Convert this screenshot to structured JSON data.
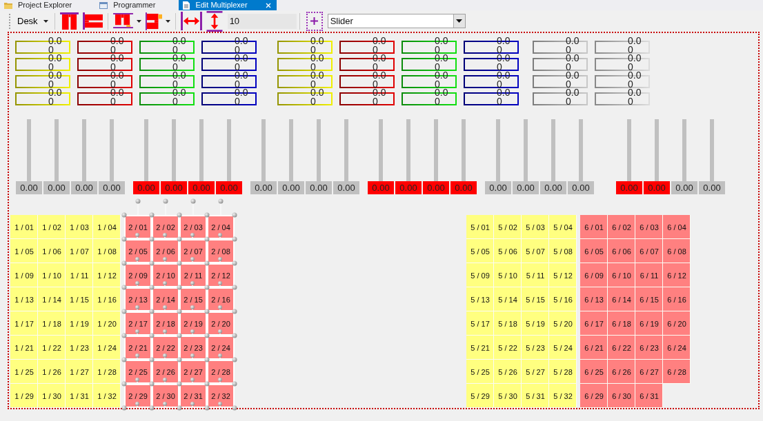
{
  "tabs": [
    {
      "label": "Project Explorer",
      "selected": false
    },
    {
      "label": "Programmer",
      "selected": false
    },
    {
      "label": "Edit Multiplexer",
      "selected": true
    }
  ],
  "toolbar": {
    "desk_menu": {
      "label": "Desk"
    },
    "spacing": {
      "value": "10"
    },
    "mode": {
      "value": "Slider"
    }
  },
  "value_groups": [
    {
      "color": "#f0f000",
      "values": [
        "0.00",
        "0.00",
        "0.00",
        "0.00"
      ]
    },
    {
      "color": "#e00000",
      "values": [
        "0.00",
        "0.00",
        "0.00",
        "0.00"
      ]
    },
    {
      "color": "#10e010",
      "values": [
        "0.00",
        "0.00",
        "0.00",
        "0.00"
      ]
    },
    {
      "color": "#0000c0",
      "values": [
        "0.00",
        "0.00",
        "0.00",
        "0.00"
      ]
    },
    {
      "color": "#f0f000",
      "values": [
        "0.00",
        "0.00",
        "0.00",
        "0.00"
      ]
    },
    {
      "color": "#e00000",
      "values": [
        "0.00",
        "0.00",
        "0.00",
        "0.00"
      ]
    },
    {
      "color": "#10e010",
      "values": [
        "0.00",
        "0.00",
        "0.00",
        "0.00"
      ]
    },
    {
      "color": "#0000c0",
      "values": [
        "0.00",
        "0.00",
        "0.00",
        "0.00"
      ]
    },
    {
      "color": "#c8c8c8",
      "values": [
        "0.00",
        "0.00",
        "0.00",
        "0.00"
      ]
    },
    {
      "color": "#dcdcdc",
      "values": [
        "0.00",
        "0.00",
        "0.00",
        "0.00"
      ]
    }
  ],
  "slider_groups": [
    {
      "sliders": [
        {
          "level": 0,
          "value": "0.00",
          "color": "#c0c0c0"
        },
        {
          "level": 0,
          "value": "0.00",
          "color": "#c0c0c0"
        },
        {
          "level": 0,
          "value": "0.00",
          "color": "#c0c0c0"
        },
        {
          "level": 0,
          "value": "0.00",
          "color": "#c0c0c0"
        }
      ]
    },
    {
      "sliders": [
        {
          "level": 0,
          "value": "0.00",
          "color": "#ff0000"
        },
        {
          "level": 0,
          "value": "0.00",
          "color": "#ff0000"
        },
        {
          "level": 0,
          "value": "0.00",
          "color": "#ff0000"
        },
        {
          "level": 0,
          "value": "0.00",
          "color": "#ff0000"
        }
      ]
    },
    {
      "sliders": [
        {
          "level": 0,
          "value": "0.00",
          "color": "#c0c0c0"
        },
        {
          "level": 0,
          "value": "0.00",
          "color": "#c0c0c0"
        },
        {
          "level": 0,
          "value": "0.00",
          "color": "#c0c0c0"
        },
        {
          "level": 0,
          "value": "0.00",
          "color": "#c0c0c0"
        }
      ]
    },
    {
      "sliders": [
        {
          "level": 0,
          "value": "0.00",
          "color": "#ff0000"
        },
        {
          "level": 0,
          "value": "0.00",
          "color": "#ff0000"
        },
        {
          "level": 0,
          "value": "0.00",
          "color": "#ff0000"
        },
        {
          "level": 0,
          "value": "0.00",
          "color": "#ff0000"
        }
      ]
    },
    {
      "sliders": [
        {
          "level": 0,
          "value": "0.00",
          "color": "#c0c0c0"
        },
        {
          "level": 0,
          "value": "0.00",
          "color": "#c0c0c0"
        },
        {
          "level": 0,
          "value": "0.00",
          "color": "#c0c0c0"
        },
        {
          "level": 0,
          "value": "0.00",
          "color": "#c0c0c0"
        }
      ]
    },
    {
      "sliders": [
        {
          "level": 0,
          "value": "0.00",
          "color": "#ff0000"
        },
        {
          "level": 0,
          "value": "0.00",
          "color": "#ff0000"
        },
        {
          "level": 0,
          "value": "0.00",
          "color": "#c0c0c0"
        },
        {
          "level": 0,
          "value": "0.00",
          "color": "#c0c0c0"
        }
      ]
    }
  ],
  "grid": {
    "groups": [
      {
        "color": "#ffff80",
        "selected": false,
        "cells": [
          "1 / 01",
          "1 / 02",
          "1 / 03",
          "1 / 04",
          "1 / 05",
          "1 / 06",
          "1 / 07",
          "1 / 08",
          "1 / 09",
          "1 / 10",
          "1 / 11",
          "1 / 12",
          "1 / 13",
          "1 / 14",
          "1 / 15",
          "1 / 16",
          "1 / 17",
          "1 / 18",
          "1 / 19",
          "1 / 20",
          "1 / 21",
          "1 / 22",
          "1 / 23",
          "1 / 24",
          "1 / 25",
          "1 / 26",
          "1 / 27",
          "1 / 28",
          "1 / 29",
          "1 / 30",
          "1 / 31",
          "1 / 32"
        ]
      },
      {
        "color": "#ff8080",
        "selected": true,
        "cells": [
          "2 / 01",
          "2 / 02",
          "2 / 03",
          "2 / 04",
          "2 / 05",
          "2 / 06",
          "2 / 07",
          "2 / 08",
          "2 / 09",
          "2 / 10",
          "2 / 11",
          "2 / 12",
          "2 / 13",
          "2 / 14",
          "2 / 15",
          "2 / 16",
          "2 / 17",
          "2 / 18",
          "2 / 19",
          "2 / 20",
          "2 / 21",
          "2 / 22",
          "2 / 23",
          "2 / 24",
          "2 / 25",
          "2 / 26",
          "2 / 27",
          "2 / 28",
          "2 / 29",
          "2 / 30",
          "2 / 31",
          "2 / 32"
        ]
      },
      {
        "color": "#ffff80",
        "selected": false,
        "cells": [
          "5 / 01",
          "5 / 02",
          "5 / 03",
          "5 / 04",
          "5 / 05",
          "5 / 06",
          "5 / 07",
          "5 / 08",
          "5 / 09",
          "5 / 10",
          "5 / 11",
          "5 / 12",
          "5 / 13",
          "5 / 14",
          "5 / 15",
          "5 / 16",
          "5 / 17",
          "5 / 18",
          "5 / 19",
          "5 / 20",
          "5 / 21",
          "5 / 22",
          "5 / 23",
          "5 / 24",
          "5 / 25",
          "5 / 26",
          "5 / 27",
          "5 / 28",
          "5 / 29",
          "5 / 30",
          "5 / 31",
          "5 / 32"
        ]
      },
      {
        "color": "#ff8080",
        "selected": false,
        "cells": [
          "6 / 01",
          "6 / 02",
          "6 / 03",
          "6 / 04",
          "6 / 05",
          "6 / 06",
          "6 / 07",
          "6 / 08",
          "6 / 09",
          "6 / 10",
          "6 / 11",
          "6 / 12",
          "6 / 13",
          "6 / 14",
          "6 / 15",
          "6 / 16",
          "6 / 17",
          "6 / 18",
          "6 / 19",
          "6 / 20",
          "6 / 21",
          "6 / 22",
          "6 / 23",
          "6 / 24",
          "6 / 25",
          "6 / 26",
          "6 / 27",
          "6 / 28",
          "6 / 29",
          "6 / 30",
          "6 / 31"
        ]
      }
    ]
  }
}
